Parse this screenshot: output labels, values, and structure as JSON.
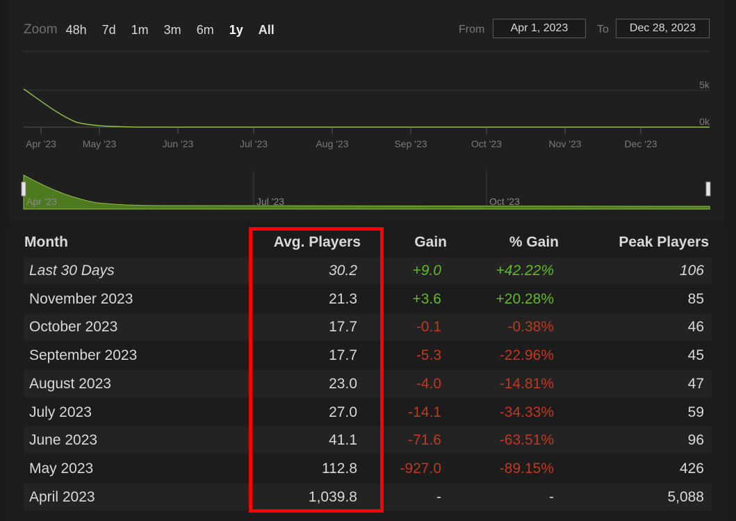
{
  "zoom": {
    "label": "Zoom",
    "options": [
      "48h",
      "7d",
      "1m",
      "3m",
      "6m",
      "1y",
      "All"
    ],
    "active": "1y"
  },
  "range": {
    "from_label": "From",
    "from_value": "Apr 1, 2023",
    "to_label": "To",
    "to_value": "Dec 28, 2023"
  },
  "main_chart": {
    "y_ticks": [
      "5k",
      "0k"
    ],
    "x_ticks": [
      "Apr '23",
      "May '23",
      "Jun '23",
      "Jul '23",
      "Aug '23",
      "Sep '23",
      "Oct '23",
      "Nov '23",
      "Dec '23"
    ]
  },
  "navigator": {
    "x_ticks": [
      "Apr '23",
      "Jul '23",
      "Oct '23"
    ]
  },
  "colors": {
    "line": "#8fbf45",
    "area": "#4d7a1f",
    "positive": "#5fbb24",
    "negative": "#c0381f",
    "highlight": "#ff0000"
  },
  "table": {
    "headers": {
      "month": "Month",
      "avg": "Avg. Players",
      "gain": "Gain",
      "pct_gain": "% Gain",
      "peak": "Peak Players"
    },
    "rows": [
      {
        "month": "Last 30 Days",
        "avg": "30.2",
        "gain": "+9.0",
        "pct_gain": "+42.22%",
        "peak": "106",
        "trend": "pos",
        "italic": true
      },
      {
        "month": "November 2023",
        "avg": "21.3",
        "gain": "+3.6",
        "pct_gain": "+20.28%",
        "peak": "85",
        "trend": "pos"
      },
      {
        "month": "October 2023",
        "avg": "17.7",
        "gain": "-0.1",
        "pct_gain": "-0.38%",
        "peak": "46",
        "trend": "neg"
      },
      {
        "month": "September 2023",
        "avg": "17.7",
        "gain": "-5.3",
        "pct_gain": "-22.96%",
        "peak": "45",
        "trend": "neg"
      },
      {
        "month": "August 2023",
        "avg": "23.0",
        "gain": "-4.0",
        "pct_gain": "-14.81%",
        "peak": "47",
        "trend": "neg"
      },
      {
        "month": "July 2023",
        "avg": "27.0",
        "gain": "-14.1",
        "pct_gain": "-34.33%",
        "peak": "59",
        "trend": "neg"
      },
      {
        "month": "June 2023",
        "avg": "41.1",
        "gain": "-71.6",
        "pct_gain": "-63.51%",
        "peak": "96",
        "trend": "neg"
      },
      {
        "month": "May 2023",
        "avg": "112.8",
        "gain": "-927.0",
        "pct_gain": "-89.15%",
        "peak": "426",
        "trend": "neg"
      },
      {
        "month": "April 2023",
        "avg": "1,039.8",
        "gain": "-",
        "pct_gain": "-",
        "peak": "5,088",
        "trend": "neutral"
      }
    ]
  }
}
